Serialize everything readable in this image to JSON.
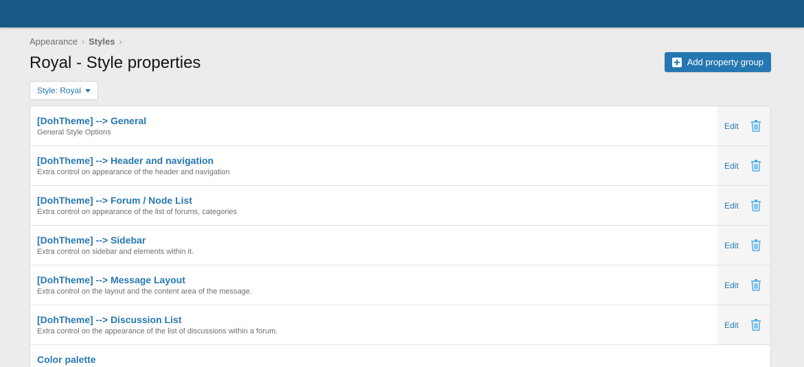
{
  "breadcrumb": {
    "items": [
      "Appearance",
      "Styles"
    ],
    "separator": "›"
  },
  "page": {
    "title": "Royal - Style properties"
  },
  "toolbar": {
    "add_label": "Add property group",
    "style_select_value": "Style: Royal"
  },
  "colors": {
    "header": "#185886",
    "accent": "#2577b1",
    "trash": "#47a7eb"
  },
  "groups": [
    {
      "title": "[DohTheme] --> General",
      "desc": "General Style Options",
      "edit": "Edit"
    },
    {
      "title": "[DohTheme] --> Header and navigation",
      "desc": "Extra control on appearance of the header and navigation",
      "edit": "Edit"
    },
    {
      "title": "[DohTheme] --> Forum / Node List",
      "desc": "Extra control on appearance of the list of forums, categories",
      "edit": "Edit"
    },
    {
      "title": "[DohTheme] --> Sidebar",
      "desc": "Extra control on sidebar and elements within it.",
      "edit": "Edit"
    },
    {
      "title": "[DohTheme] --> Message Layout",
      "desc": "Extra control on the layout and the content area of the message.",
      "edit": "Edit"
    },
    {
      "title": "[DohTheme] --> Discussion List",
      "desc": "Extra control on the appearance of the list of discussions within a forum.",
      "edit": "Edit"
    },
    {
      "title": "Color palette"
    }
  ]
}
